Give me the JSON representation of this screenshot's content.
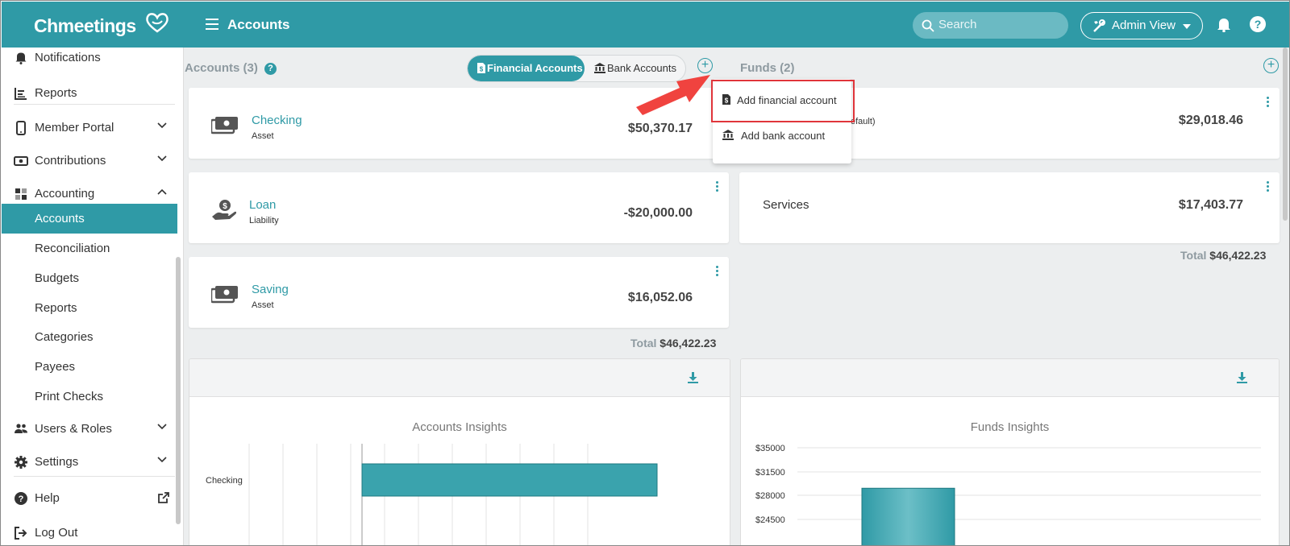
{
  "app": {
    "logo": "Chmeetings",
    "page_title": "Accounts"
  },
  "topbar": {
    "search_placeholder": "Search",
    "admin_view": "Admin View",
    "help": "?"
  },
  "sidebar": {
    "items": [
      {
        "label": "Notifications",
        "icon": "bell-icon"
      },
      {
        "label": "Reports",
        "icon": "reports-icon"
      },
      {
        "label": "Member Portal",
        "icon": "mobile-icon"
      },
      {
        "label": "Contributions",
        "icon": "money-icon"
      },
      {
        "label": "Accounting",
        "icon": "accounting-icon"
      },
      {
        "label": "Accounts"
      },
      {
        "label": "Reconciliation"
      },
      {
        "label": "Budgets"
      },
      {
        "label": "Reports"
      },
      {
        "label": "Categories"
      },
      {
        "label": "Payees"
      },
      {
        "label": "Print Checks"
      },
      {
        "label": "Users & Roles",
        "icon": "users-icon"
      },
      {
        "label": "Settings",
        "icon": "gear-icon"
      },
      {
        "label": "Help",
        "icon": "help-icon"
      },
      {
        "label": "Log Out",
        "icon": "logout-icon"
      }
    ],
    "active_item": "Accounts"
  },
  "accounts": {
    "title": "Accounts",
    "count": "(3)",
    "tab_financial": "Financial Accounts",
    "tab_bank": "Bank Accounts",
    "items": [
      {
        "name": "Checking",
        "type": "Asset",
        "amount": "$50,370.17"
      },
      {
        "name": "Loan",
        "type": "Liability",
        "amount": "-$20,000.00"
      },
      {
        "name": "Saving",
        "type": "Asset",
        "amount": "$16,052.06"
      }
    ],
    "total_label": "Total",
    "total_value": "$46,422.23"
  },
  "funds": {
    "title": "Funds",
    "count": "(2)",
    "items": [
      {
        "name": "efault)",
        "amount": "$29,018.46"
      },
      {
        "name": "Services",
        "amount": "$17,403.77"
      }
    ],
    "total_label": "Total",
    "total_value": "$46,422.23"
  },
  "dropdown": {
    "items": [
      {
        "label": "Add financial account",
        "icon": "document-dollar-icon"
      },
      {
        "label": "Add bank account",
        "icon": "bank-icon"
      }
    ]
  },
  "charts_text": {
    "accounts_title": "Accounts Insights",
    "funds_title": "Funds Insights"
  },
  "chart_data": [
    {
      "type": "bar",
      "orientation": "horizontal",
      "title": "Accounts Insights",
      "categories": [
        "Checking"
      ],
      "values": [
        50370.17
      ],
      "grid": true,
      "color": "#3aa3ad"
    },
    {
      "type": "bar",
      "title": "Funds Insights",
      "categories": [
        ""
      ],
      "values": [
        29018.46
      ],
      "y_ticks": [
        "$35000",
        "$31500",
        "$28000",
        "$24500"
      ],
      "ylim": [
        21000,
        35000
      ],
      "grid": true,
      "color": "#3aa3ad"
    }
  ],
  "colors": {
    "accent": "#2f9aa6",
    "highlight": "#e0353b",
    "arrow": "#f0433f"
  }
}
